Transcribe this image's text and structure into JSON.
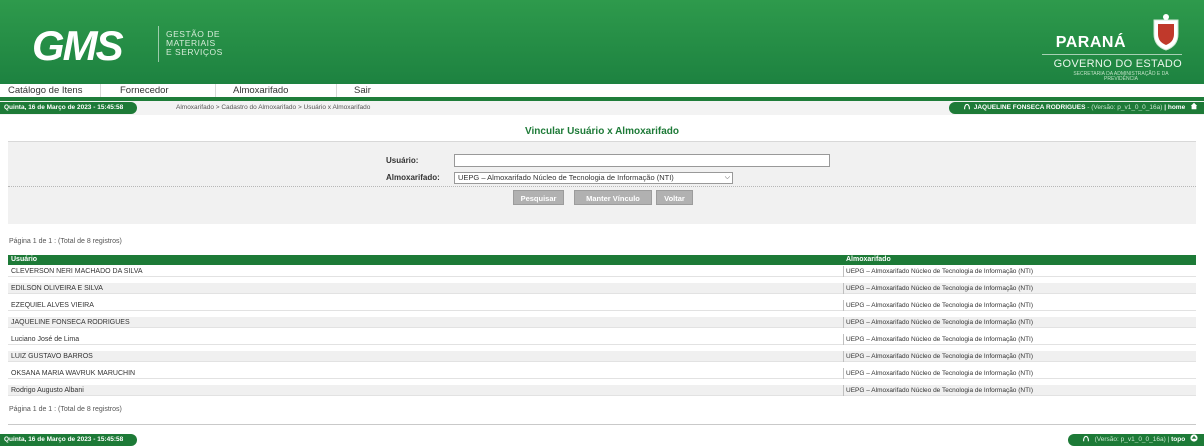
{
  "header": {
    "logo_text": "GMS",
    "logo_sub": [
      "GESTÃO DE",
      "MATERIAIS",
      "E SERVIÇOS"
    ],
    "gov_state": "PARANÁ",
    "gov_title": "GOVERNO DO ESTADO",
    "gov_secretaria": "SECRETARIA DA ADMINISTRAÇÃO E DA PREVIDÊNCIA"
  },
  "menu": {
    "items": [
      {
        "label": "Catálogo de Itens"
      },
      {
        "label": "Fornecedor"
      },
      {
        "label": "Almoxarifado"
      },
      {
        "label": "Sair"
      }
    ]
  },
  "status": {
    "date": "Quinta, 16 de Março de 2023 - 15:45:58",
    "breadcrumb": "Almoxarifado > Cadastro do Almoxarifado > Usuário x Almoxarifado",
    "user": "JAQUELINE FONSECA RODRIGUES",
    "version": "- (Versão: p_v1_0_0_16a)",
    "home_label": "home"
  },
  "page": {
    "title": "Vincular Usuário x Almoxarifado"
  },
  "form": {
    "usuario_label": "Usuário:",
    "usuario_value": "",
    "almoxarifado_label": "Almoxarifado:",
    "almoxarifado_value": "UEPG – Almoxarifado Núcleo de Tecnologia de Informação (NTI)",
    "buttons": {
      "pesquisar": "Pesquisar",
      "manter": "Manter Vínculo",
      "voltar": "Voltar"
    }
  },
  "results": {
    "pageinfo_top": "Página 1 de 1 : (Total de 8 registros)",
    "pageinfo_bottom": "Página 1 de 1 : (Total de 8 registros)",
    "columns": [
      "Usuário",
      "Almoxarifado"
    ],
    "rows": [
      [
        "CLEVERSON NERI MACHADO DA SILVA",
        "UEPG – Almoxarifado Núcleo de Tecnologia de Informação (NTI)"
      ],
      [
        "EDILSON OLIVEIRA E SILVA",
        "UEPG – Almoxarifado Núcleo de Tecnologia de Informação (NTI)"
      ],
      [
        "EZEQUIEL ALVES VIEIRA",
        "UEPG – Almoxarifado Núcleo de Tecnologia de Informação (NTI)"
      ],
      [
        "JAQUELINE FONSECA RODRIGUES",
        "UEPG – Almoxarifado Núcleo de Tecnologia de Informação (NTI)"
      ],
      [
        "Luciano José de Lima",
        "UEPG – Almoxarifado Núcleo de Tecnologia de Informação (NTI)"
      ],
      [
        "LUIZ GUSTAVO BARROS",
        "UEPG – Almoxarifado Núcleo de Tecnologia de Informação (NTI)"
      ],
      [
        "OKSANA MARIA WAVRUK MARUCHIN",
        "UEPG – Almoxarifado Núcleo de Tecnologia de Informação (NTI)"
      ],
      [
        "Rodrigo Augusto Albani",
        "UEPG – Almoxarifado Núcleo de Tecnologia de Informação (NTI)"
      ]
    ]
  },
  "footer": {
    "date": "Quinta, 16 de Março de 2023 - 15:45:58",
    "version": "(Versão: p_v1_0_0_16a)",
    "topo_label": "topo"
  },
  "colors": {
    "brand_green": "#1d7a37",
    "header_green": "#2e9a4c",
    "button_gray": "#b1b1b1"
  }
}
